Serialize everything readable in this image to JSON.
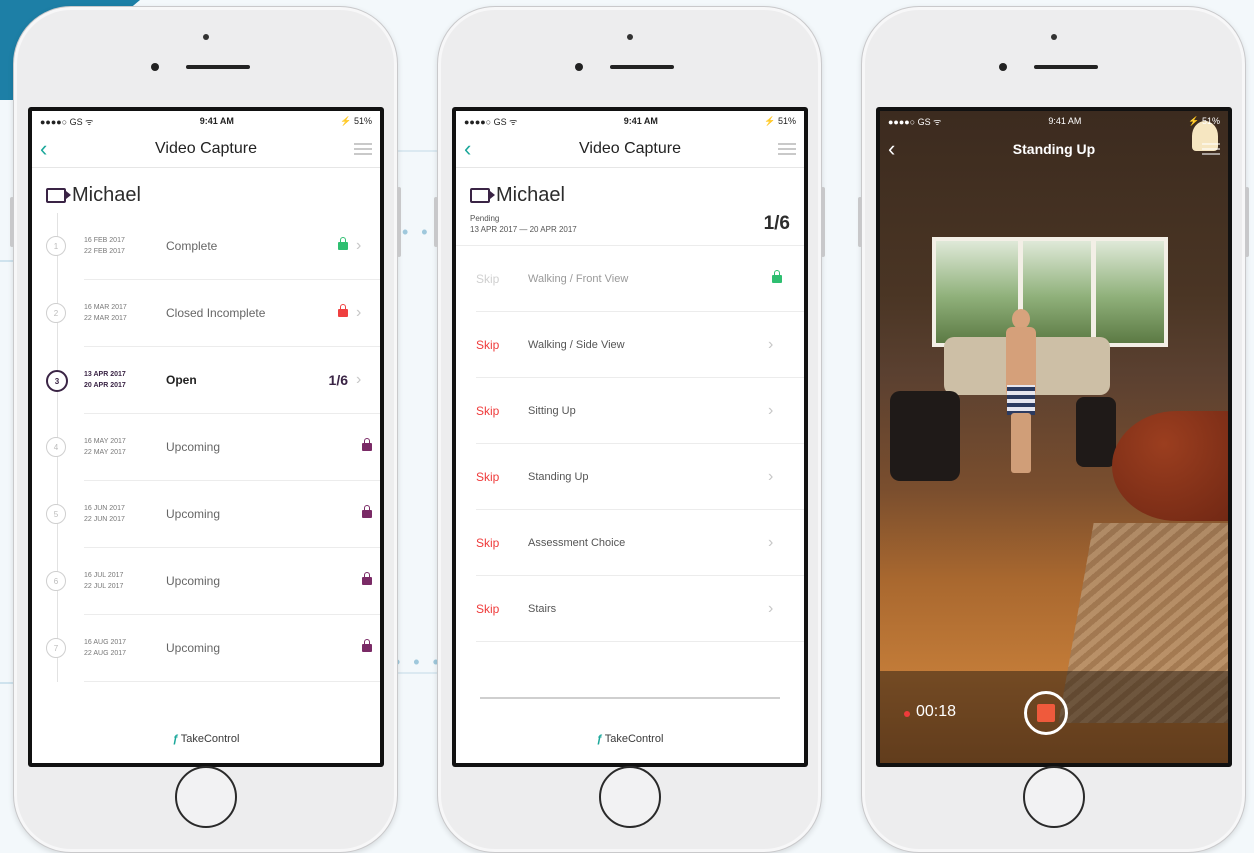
{
  "phone1": {
    "status": {
      "carrier": "●●●●○ GS ᯤ",
      "time": "9:41 AM",
      "battery": "⚡ 51%"
    },
    "title": "Video Capture",
    "patient": "Michael",
    "sessions": [
      {
        "start": "16 FEB 2017",
        "end": "22 FEB 2017",
        "state": "Complete",
        "count": "",
        "lock": "green",
        "num": "1"
      },
      {
        "start": "16 MAR 2017",
        "end": "22 MAR 2017",
        "state": "Closed Incomplete",
        "count": "",
        "lock": "red",
        "num": "2"
      },
      {
        "start": "13 APR 2017",
        "end": "20 APR 2017",
        "state": "Open",
        "count": "1/6",
        "lock": "",
        "num": "3"
      },
      {
        "start": "16 MAY 2017",
        "end": "22 MAY 2017",
        "state": "Upcoming",
        "count": "",
        "lock": "purple",
        "num": "4"
      },
      {
        "start": "16 JUN 2017",
        "end": "22 JUN 2017",
        "state": "Upcoming",
        "count": "",
        "lock": "purple",
        "num": "5"
      },
      {
        "start": "16 JUL 2017",
        "end": "22 JUL 2017",
        "state": "Upcoming",
        "count": "",
        "lock": "purple",
        "num": "6"
      },
      {
        "start": "16 AUG 2017",
        "end": "22 AUG 2017",
        "state": "Upcoming",
        "count": "",
        "lock": "purple",
        "num": "7"
      }
    ],
    "brand": "TakeControl"
  },
  "phone2": {
    "status": {
      "carrier": "●●●●○ GS ᯤ",
      "time": "9:41 AM",
      "battery": "⚡ 51%"
    },
    "title": "Video Capture",
    "patient": "Michael",
    "pending_label": "Pending",
    "pending_dates": "13 APR 2017 — 20 APR 2017",
    "count": "1/6",
    "tasks": [
      {
        "skip": "Skip",
        "name": "Walking / Front View",
        "done": true
      },
      {
        "skip": "Skip",
        "name": "Walking / Side View",
        "done": false
      },
      {
        "skip": "Skip",
        "name": "Sitting Up",
        "done": false
      },
      {
        "skip": "Skip",
        "name": "Standing Up",
        "done": false
      },
      {
        "skip": "Skip",
        "name": "Assessment Choice",
        "done": false
      },
      {
        "skip": "Skip",
        "name": "Stairs",
        "done": false
      }
    ],
    "brand": "TakeControl"
  },
  "phone3": {
    "status": {
      "carrier": "●●●●○ GS ᯤ",
      "time": "9:41 AM",
      "battery": "⚡ 51%"
    },
    "title": "Standing Up",
    "rec_time": "00:18"
  },
  "icons": {
    "back": "‹",
    "chevron": "›"
  },
  "colors": {
    "accent": "#1aa79a",
    "primary": "#3a2445",
    "skip": "#ef3b3b",
    "lock_green": "#2fbf71",
    "lock_red": "#ef4040",
    "lock_purple": "#7a2a66"
  }
}
